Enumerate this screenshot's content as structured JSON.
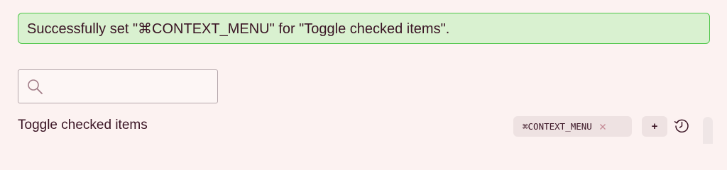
{
  "notification": {
    "message": "Successfully set \"⌘CONTEXT_MENU\" for \"Toggle checked items\".",
    "background": "#d9f1d0",
    "border": "#4fc64a"
  },
  "search": {
    "value": "",
    "placeholder": "",
    "icon": "search-icon"
  },
  "commands": [
    {
      "label": "Toggle checked items",
      "hotkey": "⌘CONTEXT_MENU",
      "remove_icon": "close-icon",
      "add_label": "+",
      "reset_icon": "restore-default-icon"
    }
  ],
  "colors": {
    "page_background": "#fcf2f1",
    "text": "#3a1424",
    "chip_background": "#eee2e2"
  }
}
